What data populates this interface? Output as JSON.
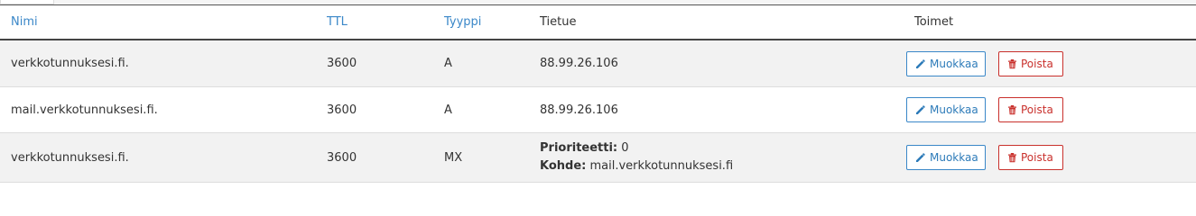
{
  "table": {
    "headers": {
      "name": "Nimi",
      "ttl": "TTL",
      "type": "Tyyppi",
      "record": "Tietue",
      "actions": "Toimet"
    },
    "rows": [
      {
        "name": "verkkotunnuksesi.fi.",
        "ttl": "3600",
        "type": "A",
        "record": "88.99.26.106",
        "edit_label": "Muokkaa",
        "delete_label": "Poista"
      },
      {
        "name": "mail.verkkotunnuksesi.fi.",
        "ttl": "3600",
        "type": "A",
        "record": "88.99.26.106",
        "edit_label": "Muokkaa",
        "delete_label": "Poista"
      },
      {
        "name": "verkkotunnuksesi.fi.",
        "ttl": "3600",
        "type": "MX",
        "priority_label": "Prioriteetti:",
        "priority_value": "0",
        "target_label": "Kohde:",
        "target_value": "mail.verkkotunnuksesi.fi",
        "edit_label": "Muokkaa",
        "delete_label": "Poista"
      }
    ]
  },
  "icons": {
    "edit": "pencil-icon",
    "delete": "trash-icon"
  },
  "colors": {
    "link": "#3a87c8",
    "danger": "#c9302c",
    "row_stripe": "#f2f2f2"
  }
}
